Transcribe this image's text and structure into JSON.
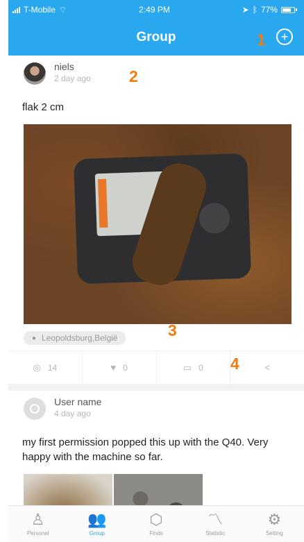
{
  "status_bar": {
    "carrier": "T-Mobile",
    "time": "2:49 PM",
    "battery": "77%"
  },
  "header": {
    "title": "Group",
    "add_icon": "plus-circle-icon"
  },
  "markers": [
    "1",
    "2",
    "3",
    "4"
  ],
  "posts": [
    {
      "author": "niels",
      "time": "2 day ago",
      "text": "flak 2 cm",
      "location": "Leopoldsburg,België",
      "views": "14",
      "likes": "0",
      "comments": "0"
    },
    {
      "author": "User name",
      "time": "4 day ago",
      "text": "my first permission popped this up with the Q40. Very happy with the machine so far."
    }
  ],
  "tabs": [
    {
      "label": "Personal",
      "icon": "person-icon"
    },
    {
      "label": "Group",
      "icon": "group-icon",
      "active": true
    },
    {
      "label": "Finds",
      "icon": "box-icon"
    },
    {
      "label": "Statistic",
      "icon": "chart-icon"
    },
    {
      "label": "Setting",
      "icon": "settings-icon"
    }
  ],
  "colors": {
    "primary": "#2aa8ef",
    "marker": "#f07a12"
  }
}
